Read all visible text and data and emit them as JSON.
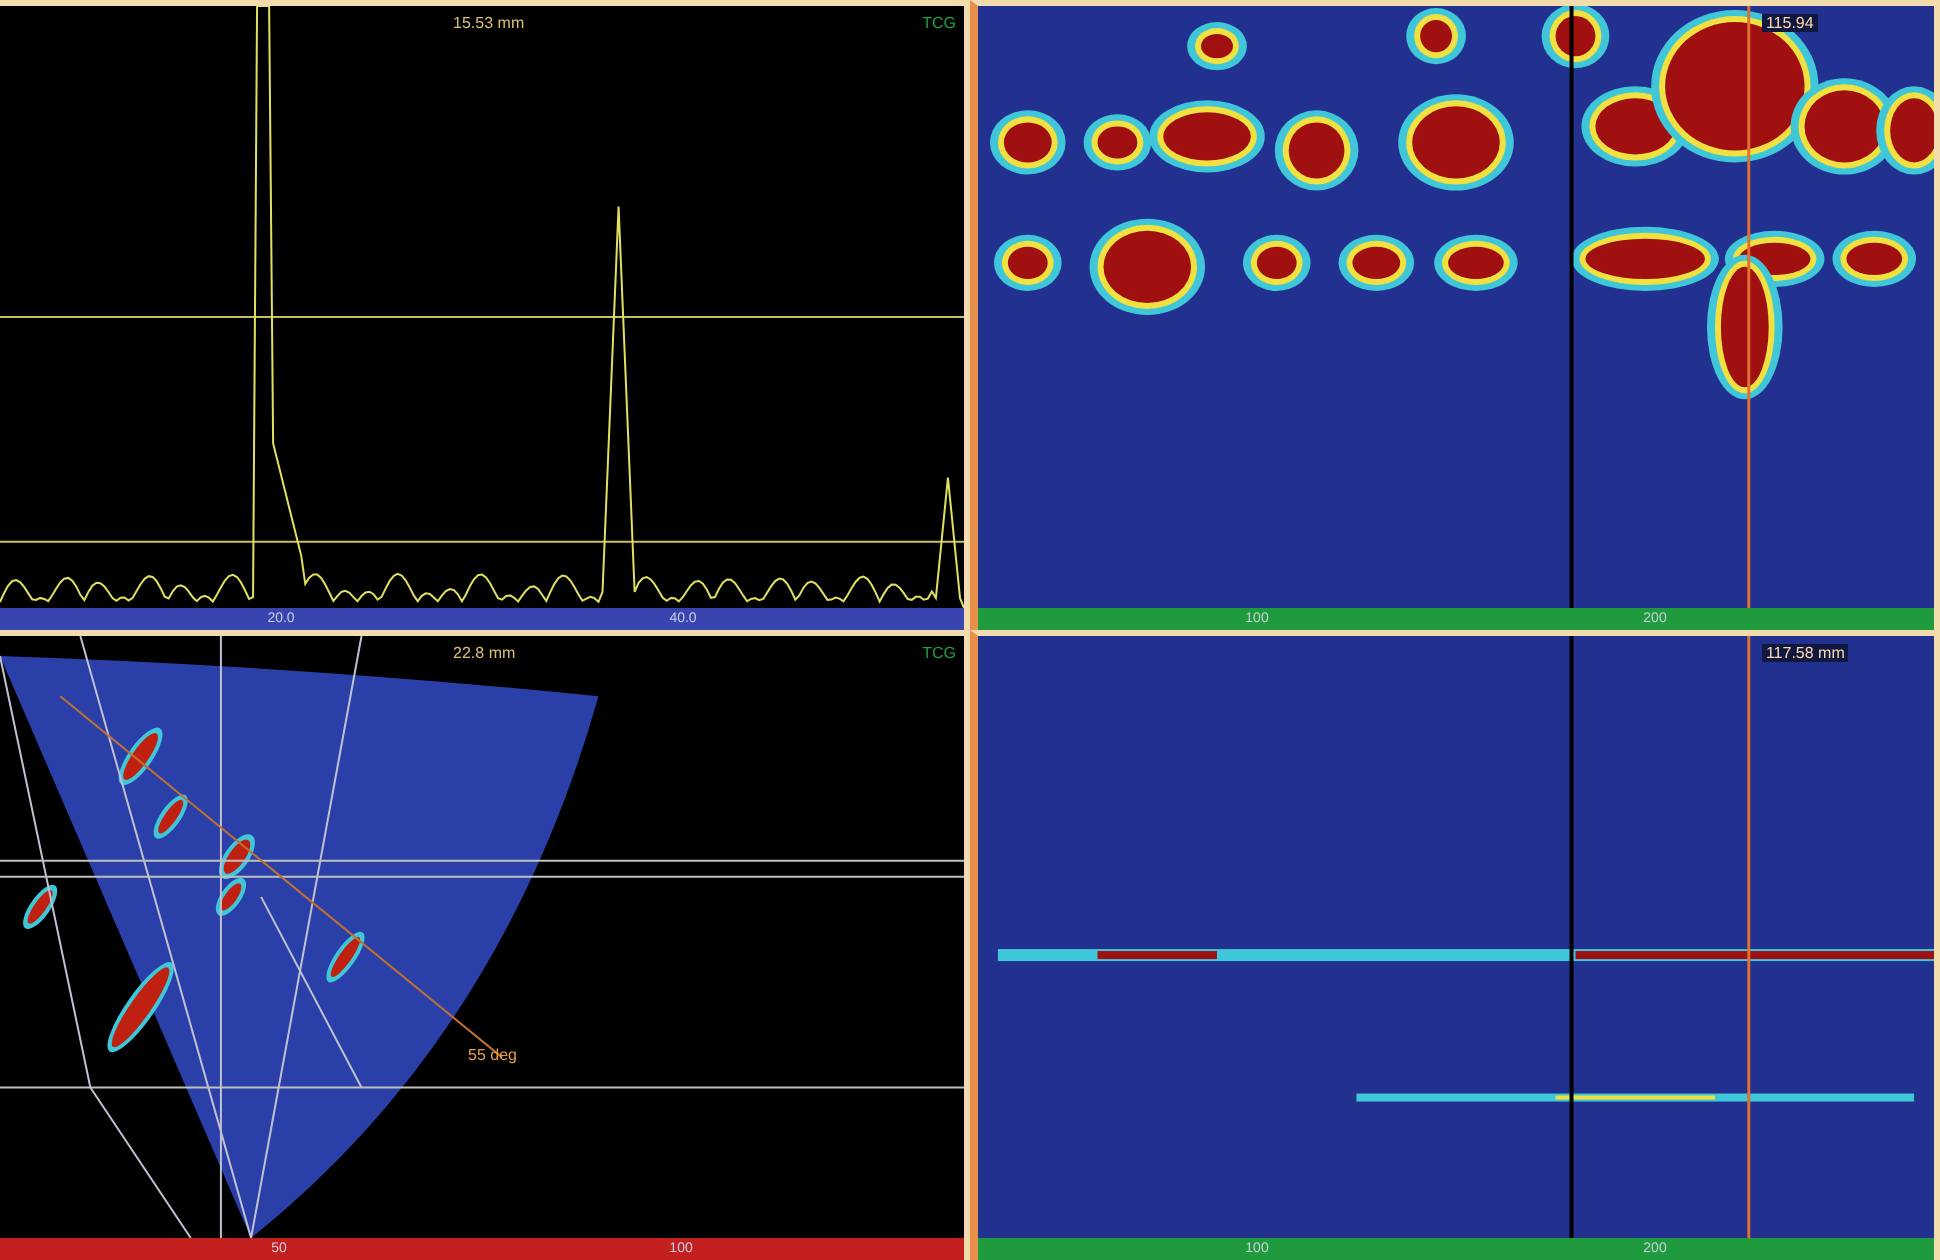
{
  "panels": [
    {
      "kind": "ascan",
      "readout": "15.53 mm",
      "gain_mode": "TCG",
      "ticks": [
        "20.0",
        "40.0"
      ]
    },
    {
      "kind": "cscan",
      "readout": "115.94",
      "ticks": [
        "100",
        "200"
      ]
    },
    {
      "kind": "sscan",
      "readout": "22.8 mm",
      "gain_mode": "TCG",
      "angle_label": "55 deg",
      "ticks": [
        "50",
        "100"
      ]
    },
    {
      "kind": "bscan",
      "readout": "117.58 mm",
      "ticks": [
        "100",
        "200"
      ]
    }
  ]
}
